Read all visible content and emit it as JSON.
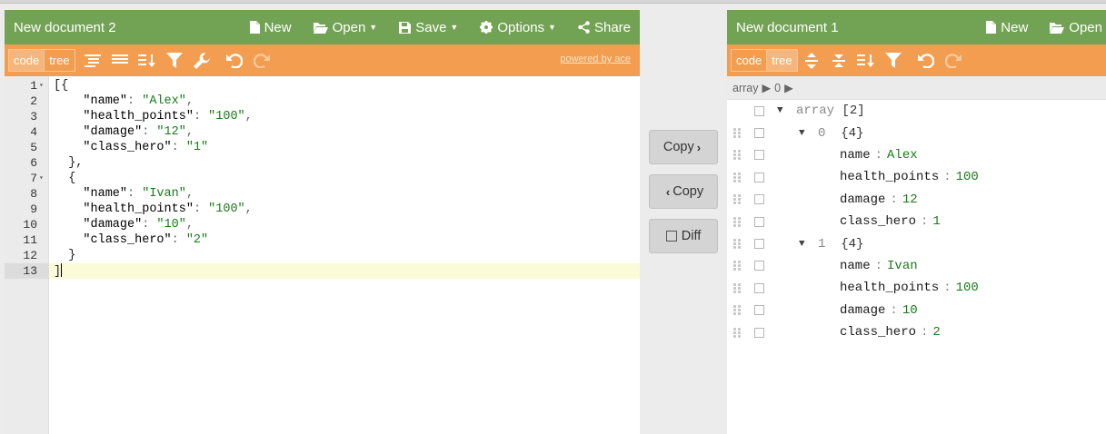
{
  "left": {
    "title": "New document 2",
    "menu": {
      "new": "New",
      "open": "Open",
      "save": "Save",
      "options": "Options",
      "share": "Share"
    },
    "modes": {
      "code": "code",
      "tree": "tree"
    },
    "powered": "powered by ace",
    "lines": [
      {
        "n": "1",
        "fold": "▾",
        "code": "[{"
      },
      {
        "n": "2",
        "fold": "",
        "code": "    \"name\": \"Alex\","
      },
      {
        "n": "3",
        "fold": "",
        "code": "    \"health_points\": \"100\","
      },
      {
        "n": "4",
        "fold": "",
        "code": "    \"damage\": \"12\","
      },
      {
        "n": "5",
        "fold": "",
        "code": "    \"class_hero\": \"1\""
      },
      {
        "n": "6",
        "fold": "",
        "code": "  },"
      },
      {
        "n": "7",
        "fold": "▾",
        "code": "  {"
      },
      {
        "n": "8",
        "fold": "",
        "code": "    \"name\": \"Ivan\","
      },
      {
        "n": "9",
        "fold": "",
        "code": "    \"health_points\": \"100\","
      },
      {
        "n": "10",
        "fold": "",
        "code": "    \"damage\": \"10\","
      },
      {
        "n": "11",
        "fold": "",
        "code": "    \"class_hero\": \"2\""
      },
      {
        "n": "12",
        "fold": "",
        "code": "  }"
      },
      {
        "n": "13",
        "fold": "",
        "code": "]"
      }
    ]
  },
  "middle": {
    "copy_right": "Copy",
    "copy_left": "Copy",
    "diff": "Diff"
  },
  "right": {
    "title": "New document 1",
    "menu": {
      "new": "New",
      "open": "Open"
    },
    "modes": {
      "code": "code",
      "tree": "tree"
    },
    "nav": [
      "array",
      "0"
    ],
    "tree": [
      {
        "type": "root",
        "label": "array",
        "meta": "[2]"
      },
      {
        "type": "obj",
        "index": "0",
        "meta": "{4}"
      },
      {
        "type": "field",
        "key": "name",
        "value": "Alex"
      },
      {
        "type": "field",
        "key": "health_points",
        "value": "100"
      },
      {
        "type": "field",
        "key": "damage",
        "value": "12"
      },
      {
        "type": "field",
        "key": "class_hero",
        "value": "1"
      },
      {
        "type": "obj",
        "index": "1",
        "meta": "{4}"
      },
      {
        "type": "field",
        "key": "name",
        "value": "Ivan"
      },
      {
        "type": "field",
        "key": "health_points",
        "value": "100"
      },
      {
        "type": "field",
        "key": "damage",
        "value": "10"
      },
      {
        "type": "field",
        "key": "class_hero",
        "value": "2"
      }
    ]
  }
}
